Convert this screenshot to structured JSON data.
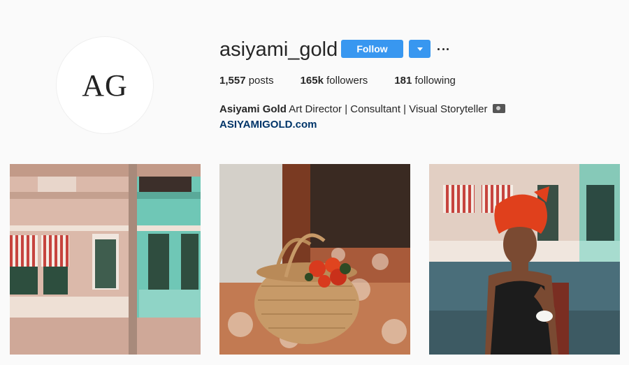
{
  "profile": {
    "avatar_text": "AG",
    "username": "asiyami_gold",
    "follow_label": "Follow"
  },
  "stats": {
    "posts_count": "1,557",
    "posts_label": "posts",
    "followers_count": "165k",
    "followers_label": "followers",
    "following_count": "181",
    "following_label": "following"
  },
  "bio": {
    "name": "Asiyami Gold",
    "text": "Art Director | Consultant | Visual Storyteller",
    "camera_icon": "camera-icon",
    "link": "ASIYAMIGOLD.com"
  },
  "posts": [
    {
      "subject": "colonial-buildings"
    },
    {
      "subject": "woven-basket-with-roses"
    },
    {
      "subject": "woman-in-red-headwrap-with-cup"
    }
  ],
  "colors": {
    "accent": "#3897f0",
    "link": "#003569",
    "background": "#fafafa"
  }
}
